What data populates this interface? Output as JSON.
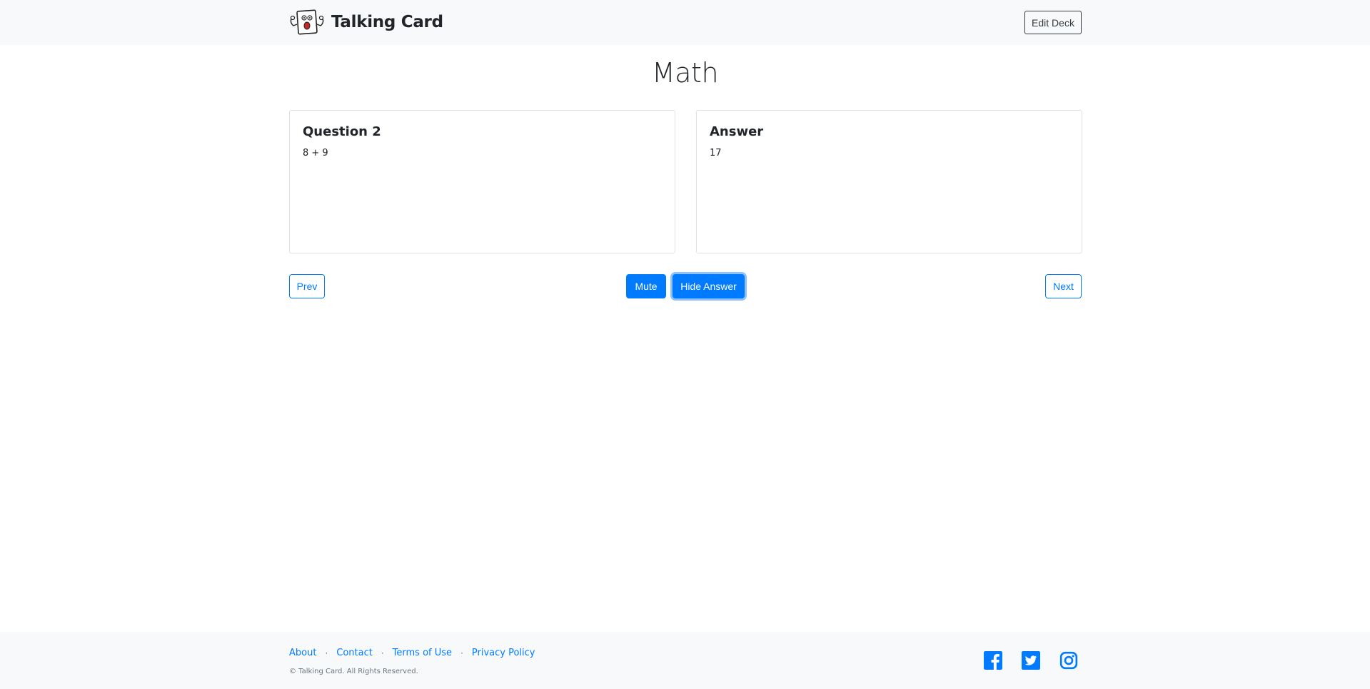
{
  "navbar": {
    "brand_name": "Talking Card",
    "logo_icon": "talking-card-logo-icon",
    "edit_deck_label": "Edit Deck"
  },
  "deck": {
    "title": "Math"
  },
  "question_card": {
    "title": "Question 2",
    "text": "8 + 9"
  },
  "answer_card": {
    "title": "Answer",
    "text": "17"
  },
  "controls": {
    "prev_label": "Prev",
    "mute_label": "Mute",
    "hide_answer_label": "Hide Answer",
    "next_label": "Next"
  },
  "footer": {
    "links": [
      "About",
      "Contact",
      "Terms of Use",
      "Privacy Policy"
    ],
    "separator": "·",
    "copyright": "© Talking Card. All Rights Reserved.",
    "social": [
      "facebook-icon",
      "twitter-icon",
      "instagram-icon"
    ]
  },
  "colors": {
    "primary": "#007bff",
    "navbar_bg": "#f8f9fa",
    "text": "#212529",
    "muted": "#6c757d"
  }
}
